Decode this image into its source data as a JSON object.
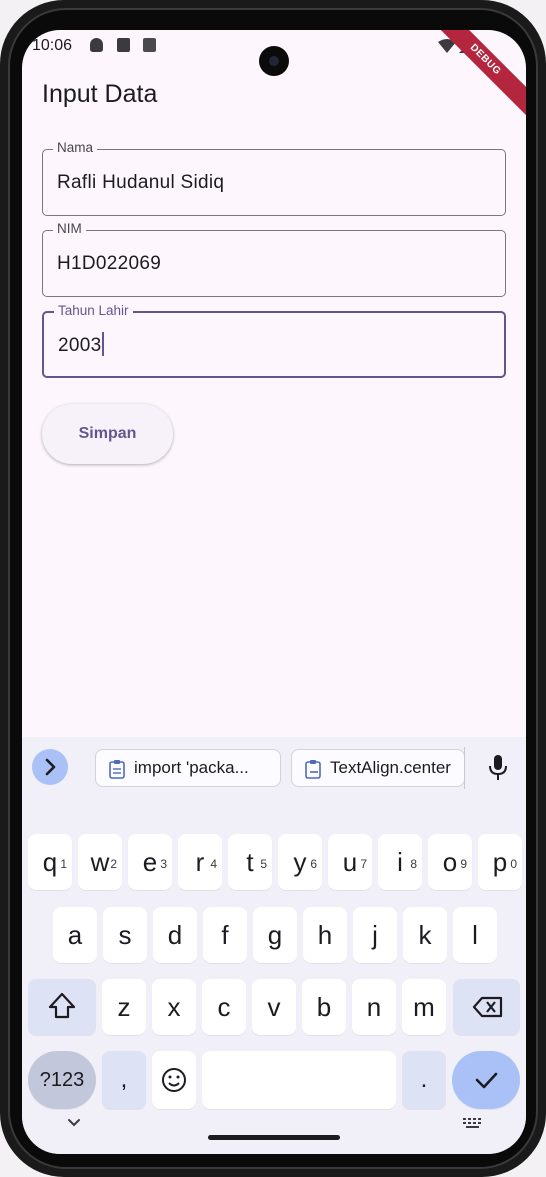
{
  "status_bar": {
    "time": "10:06",
    "debug_banner": "DEBUG"
  },
  "app": {
    "title": "Input Data"
  },
  "form": {
    "fields": [
      {
        "label": "Nama",
        "value": "Rafli Hudanul Sidiq"
      },
      {
        "label": "NIM",
        "value": "H1D022069"
      },
      {
        "label": "Tahun Lahir",
        "value": "2003"
      }
    ],
    "submit_label": "Simpan"
  },
  "keyboard": {
    "suggestions": [
      "import 'packa...",
      "TextAlign.center"
    ],
    "row1": [
      {
        "k": "q",
        "n": "1"
      },
      {
        "k": "w",
        "n": "2"
      },
      {
        "k": "e",
        "n": "3"
      },
      {
        "k": "r",
        "n": "4"
      },
      {
        "k": "t",
        "n": "5"
      },
      {
        "k": "y",
        "n": "6"
      },
      {
        "k": "u",
        "n": "7"
      },
      {
        "k": "i",
        "n": "8"
      },
      {
        "k": "o",
        "n": "9"
      },
      {
        "k": "p",
        "n": "0"
      }
    ],
    "row2": [
      "a",
      "s",
      "d",
      "f",
      "g",
      "h",
      "j",
      "k",
      "l"
    ],
    "row3": [
      "z",
      "x",
      "c",
      "v",
      "b",
      "n",
      "m"
    ],
    "symbols_label": "?123",
    "comma": ",",
    "period": "."
  }
}
